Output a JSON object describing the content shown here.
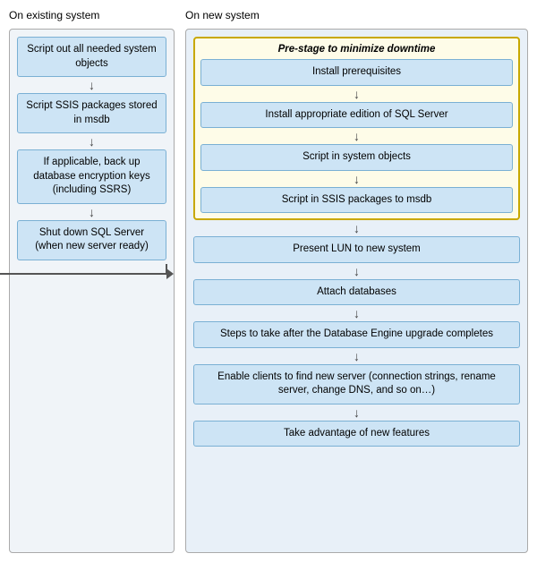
{
  "leftLabel": "On existing system",
  "rightLabel": "On new system",
  "left": {
    "boxes": [
      "Script out all needed system objects",
      "Script SSIS packages stored in msdb",
      "If applicable, back up database encryption keys (including SSRS)",
      "Shut down SQL Server (when new server ready)"
    ]
  },
  "right": {
    "prestageLabel": "Pre-stage to minimize downtime",
    "prestageBoxes": [
      "Install prerequisites",
      "Install appropriate edition of SQL Server",
      "Script in system objects",
      "Script in SSIS packages to msdb"
    ],
    "mainBoxes": [
      "Present LUN to new system",
      "Attach databases",
      "Steps to take after the Database Engine upgrade completes",
      "Enable clients to find new server (connection strings, rename server, change DNS, and so on…)",
      "Take advantage of new features"
    ]
  }
}
